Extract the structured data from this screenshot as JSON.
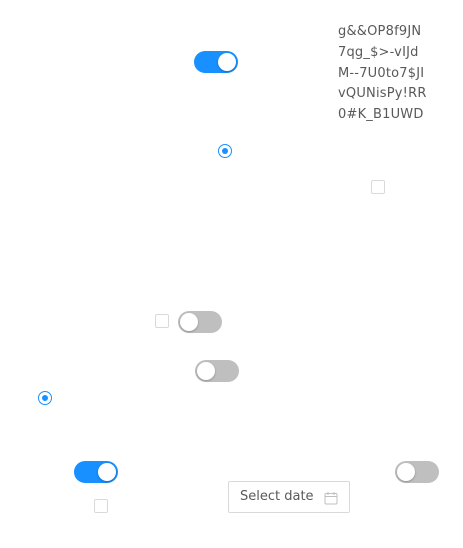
{
  "text_block": {
    "content": "g&&OP8f9JN7qg_$>-vIJdM--7U0to7$JIvQUNisPy!RR0#K_B1UWD"
  },
  "date_picker": {
    "placeholder": "Select date",
    "icon": "calendar-icon"
  },
  "controls": {
    "toggle_1": {
      "checked": true
    },
    "toggle_2": {
      "checked": false
    },
    "toggle_3": {
      "checked": false
    },
    "toggle_4": {
      "checked": true
    },
    "toggle_5": {
      "checked": false
    },
    "radio_1": {
      "checked": true
    },
    "radio_2": {
      "checked": true
    },
    "checkbox_1": {
      "checked": false
    },
    "checkbox_2": {
      "checked": false
    },
    "checkbox_3": {
      "checked": false
    }
  },
  "colors": {
    "accent": "#1890ff",
    "toggle_off": "#bfbfbf",
    "border": "#d9d9d9",
    "text": "#595959"
  }
}
